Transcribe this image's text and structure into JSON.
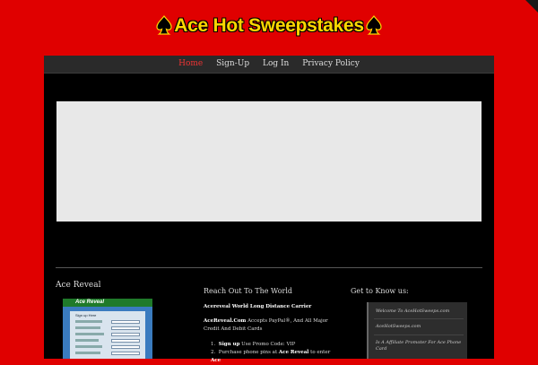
{
  "brand": {
    "title": "Ace Hot Sweepstakes",
    "colors": {
      "background": "#e00000",
      "title": "#ffd700",
      "content": "#000000",
      "nav": "#2a2a2a",
      "active": "#ee3333"
    }
  },
  "nav": {
    "items": [
      {
        "label": "Home",
        "active": true
      },
      {
        "label": "Sign-Up",
        "active": false
      },
      {
        "label": "Log In",
        "active": false
      },
      {
        "label": "Privacy Policy",
        "active": false
      }
    ]
  },
  "widgets": {
    "left": {
      "title": "Ace Reveal",
      "image_title": "Ace Reveal",
      "image_subtitle": "Sign up Here"
    },
    "middle": {
      "title": "Reach Out To The World",
      "heading": "Acereveal World Long Distance Carrier",
      "para_bold": "AceReveal.Com",
      "para_text": " Accepts  PayPal®, And All Major Credit And Debit Cards",
      "step1_bold": "Sign up",
      "step1_text": "  Use Promo Code: VIP",
      "step2_text": "Purchase phone pins at ",
      "step2_bold": "Ace Reveal",
      "step2_tail": " to enter ",
      "step2_bold2": "Ace"
    },
    "right": {
      "title": "Get to Know us:",
      "items": [
        "Welcome To AceHotSweeps.com",
        "AceHotSweeps.com",
        "Is A  Affiliate Promoter For Ace Phone Card"
      ]
    }
  }
}
